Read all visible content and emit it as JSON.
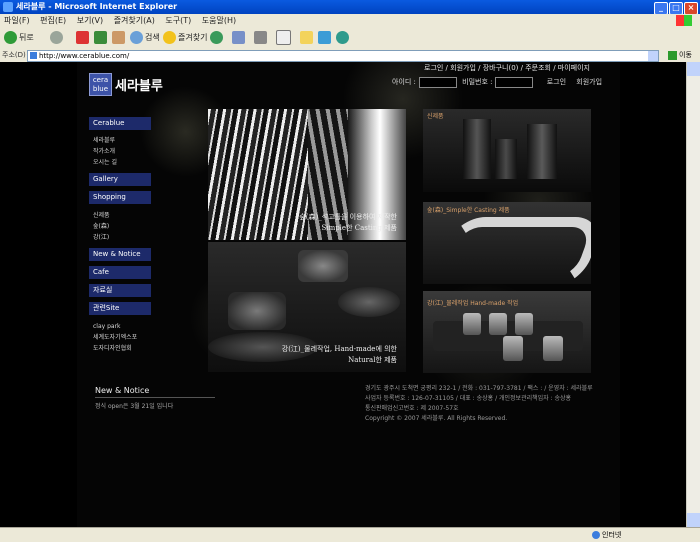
{
  "window": {
    "title": "세라블루 - Microsoft Internet Explorer",
    "buttons": [
      "_",
      "□",
      "×"
    ]
  },
  "menu": [
    "파일(F)",
    "편집(E)",
    "보기(V)",
    "즐겨찾기(A)",
    "도구(T)",
    "도움말(H)"
  ],
  "toolbar": {
    "back": "뒤로",
    "search": "검색",
    "favorites": "즐겨찾기"
  },
  "address": {
    "label": "주소(D)",
    "url": "http://www.cerablue.com/",
    "go": "이동"
  },
  "status": {
    "zone": "인터넷"
  },
  "site": {
    "logo": {
      "mark_line1": "cera",
      "mark_line2": "blue",
      "name": "세라블루"
    },
    "top_links": [
      "로그인",
      "회원가입",
      "장바구니(0)",
      "주문조회",
      "마이페이지"
    ],
    "login": {
      "id_label": "아이디 :",
      "pw_label": "비밀번호 :",
      "login_btn": "로그인",
      "join_btn": "회원가입"
    },
    "nav": [
      {
        "head": "Cerablue",
        "subs": [
          "세라블루",
          "작가소개",
          "오시는 길"
        ]
      },
      {
        "head": "Gallery",
        "subs": []
      },
      {
        "head": "Shopping",
        "subs": [
          "신제품",
          "숲(森)",
          "강(江)"
        ]
      },
      {
        "head": "New & Notice",
        "subs": []
      },
      {
        "head": "Cafe",
        "subs": []
      },
      {
        "head": "자료실",
        "subs": []
      },
      {
        "head": "관련Site",
        "subs": [
          "clay park",
          "세계도자기엑스포",
          "도자디자인협회"
        ]
      }
    ],
    "captions": {
      "forest_line1": "숲(森)_석고틀을 이용하여 제작한",
      "forest_line2": "Simple한 Casting 제품",
      "river_line1": "강(江)_물레작업, Hand-made에 의한",
      "river_line2": "Natural한 제품",
      "new_label": "신제품",
      "forest_small": "숲(森)_Simple한 Casting 제품",
      "river_small": "강(江)_물레작업 Hand-made 작업"
    },
    "news": {
      "title": "New & Notice",
      "item": "정식 open은 3월 21일 입니다"
    },
    "footer": [
      "경기도 광주시 도척면 궁평리 232-1 / 전화 : 031-797-3781 / 팩스 : / 운영자 : 세라블루",
      "사업자 등록번호 : 126-07-31105 / 대표 : 송상홍 / 개인정보관리책임자 : 송상홍",
      "통신판매업신고번호 : 제 2007-57호",
      "Copyright © 2007 세라블루. All Rights Reserved."
    ]
  }
}
